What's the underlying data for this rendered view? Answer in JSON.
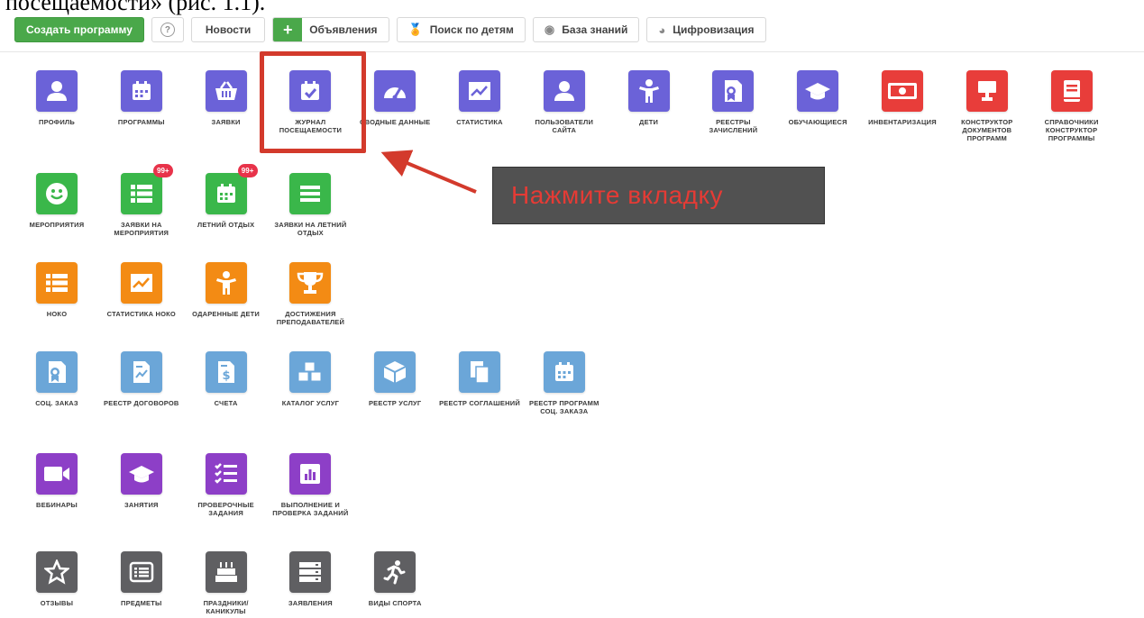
{
  "document_fragment": "посещаемости» (рис. 1.1).",
  "toolbar": {
    "create_program": "Создать программу",
    "help": "?",
    "news": "Новости",
    "ads": "Объявления",
    "child_search": "Поиск по детям",
    "knowledge_base": "База знаний",
    "digitization": "Цифровизация"
  },
  "apps": [
    {
      "label": "ПРОФИЛЬ",
      "icon": "user-icon",
      "color": "#6b62d8"
    },
    {
      "label": "ПРОГРАММЫ",
      "icon": "calendar-icon",
      "color": "#6b62d8"
    },
    {
      "label": "ЗАЯВКИ",
      "icon": "basket-icon",
      "color": "#6b62d8"
    },
    {
      "label": "ЖУРНАЛ ПОСЕЩАЕМОСТИ",
      "icon": "calendar-check-icon",
      "color": "#6b62d8"
    },
    {
      "label": "СВОДНЫЕ ДАННЫЕ",
      "icon": "gauge-icon",
      "color": "#6b62d8"
    },
    {
      "label": "СТАТИСТИКА",
      "icon": "line-chart-icon",
      "color": "#6b62d8"
    },
    {
      "label": "ПОЛЬЗОВАТЕЛИ САЙТА",
      "icon": "user-icon",
      "color": "#6b62d8"
    },
    {
      "label": "ДЕТИ",
      "icon": "child-icon",
      "color": "#6b62d8"
    },
    {
      "label": "РЕЕСТРЫ ЗАЧИСЛЕНИЙ",
      "icon": "certificate-icon",
      "color": "#6b62d8"
    },
    {
      "label": "ОБУЧАЮЩИЕСЯ",
      "icon": "graduation-cap-icon",
      "color": "#6b62d8"
    },
    {
      "label": "ИНВЕНТАРИЗАЦИЯ",
      "icon": "money-icon",
      "color": "#e83d3a"
    },
    {
      "label": "КОНСТРУКТОР ДОКУМЕНТОВ ПРОГРАММ",
      "icon": "stamp-icon",
      "color": "#e83d3a"
    },
    {
      "label": "СПРАВОЧНИКИ КОНСТРУКТОР ПРОГРАММЫ",
      "icon": "book-icon",
      "color": "#e83d3a"
    },
    {
      "label": "МЕРОПРИЯТИЯ",
      "icon": "smile-icon",
      "color": "#3ab74a"
    },
    {
      "label": "ЗАЯВКИ НА МЕРОПРИЯТИЯ",
      "icon": "list-icon",
      "color": "#3ab74a",
      "badge": "99+"
    },
    {
      "label": "ЛЕТНИЙ ОТДЫХ",
      "icon": "calendar-icon",
      "color": "#3ab74a",
      "badge": "99+"
    },
    {
      "label": "ЗАЯВКИ НА ЛЕТНИЙ ОТДЫХ",
      "icon": "lines-icon",
      "color": "#3ab74a"
    },
    {
      "label": "НОКО",
      "icon": "list-icon",
      "color": "#f38b14"
    },
    {
      "label": "СТАТИСТИКА НОКО",
      "icon": "line-chart-icon",
      "color": "#f38b14"
    },
    {
      "label": "ОДАРЕННЫЕ ДЕТИ",
      "icon": "child-icon",
      "color": "#f38b14"
    },
    {
      "label": "ДОСТИЖЕНИЯ ПРЕПОДАВАТЕЛЕЙ",
      "icon": "trophy-icon",
      "color": "#f38b14"
    },
    {
      "label": "СОЦ. ЗАКАЗ",
      "icon": "certificate-icon",
      "color": "#6ba6d8"
    },
    {
      "label": "РЕЕСТР ДОГОВОРОВ",
      "icon": "contract-icon",
      "color": "#6ba6d8"
    },
    {
      "label": "СЧЕТА",
      "icon": "invoice-icon",
      "color": "#6ba6d8"
    },
    {
      "label": "КАТАЛОГ УСЛУГ",
      "icon": "cubes-icon",
      "color": "#6ba6d8"
    },
    {
      "label": "РЕЕСТР УСЛУГ",
      "icon": "cube-icon",
      "color": "#6ba6d8"
    },
    {
      "label": "РЕЕСТР СОГЛАШЕНИЙ",
      "icon": "copy-icon",
      "color": "#6ba6d8"
    },
    {
      "label": "РЕЕСТР ПРОГРАММ СОЦ. ЗАКАЗА",
      "icon": "calendar-icon",
      "color": "#6ba6d8"
    },
    {
      "label": "ВЕБИНАРЫ",
      "icon": "video-icon",
      "color": "#8d3fc7"
    },
    {
      "label": "ЗАНЯТИЯ",
      "icon": "graduation-cap-icon",
      "color": "#8d3fc7"
    },
    {
      "label": "ПРОВЕРОЧНЫЕ ЗАДАНИЯ",
      "icon": "checklist-icon",
      "color": "#8d3fc7"
    },
    {
      "label": "ВЫПОЛНЕНИЕ И ПРОВЕРКА ЗАДАНИЙ",
      "icon": "bar-chart-icon",
      "color": "#8d3fc7"
    },
    {
      "label": "ОТЗЫВЫ",
      "icon": "star-icon",
      "color": "#5f5f62"
    },
    {
      "label": "ПРЕДМЕТЫ",
      "icon": "list-box-icon",
      "color": "#5f5f62"
    },
    {
      "label": "ПРАЗДНИКИ/ КАНИКУЛЫ",
      "icon": "cake-icon",
      "color": "#5f5f62"
    },
    {
      "label": "ЗАЯВЛЕНИЯ",
      "icon": "server-icon",
      "color": "#5f5f62"
    },
    {
      "label": "ВИДЫ СПОРТА",
      "icon": "running-icon",
      "color": "#5f5f62"
    }
  ],
  "callout": {
    "text": "Нажмите вкладку"
  }
}
